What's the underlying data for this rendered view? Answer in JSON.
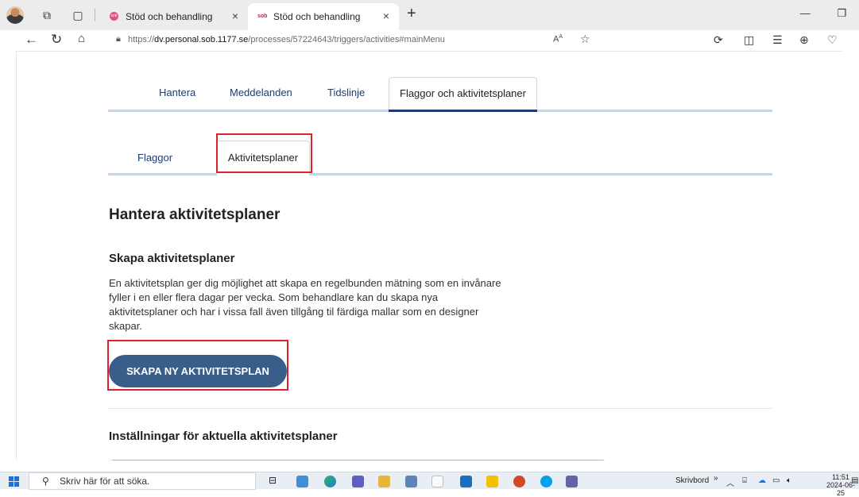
{
  "browser": {
    "tabs": [
      {
        "title": "Stöd och behandling",
        "active": false
      },
      {
        "title": "Stöd och behandling",
        "active": true
      }
    ],
    "url_prefix": "https://",
    "url_host": "dv.personal.sob.1177.se",
    "url_path": "/processes/57224643/triggers/activities#mainMenu",
    "read_aloud_label": "A̶",
    "new_tab_glyph": "+",
    "window": {
      "minimize": "—",
      "restore": "❐"
    }
  },
  "main_tabs": [
    {
      "label": "Hantera"
    },
    {
      "label": "Meddelanden"
    },
    {
      "label": "Tidslinje"
    },
    {
      "label": "Flaggor och aktivitetsplaner",
      "active": true
    }
  ],
  "sub_tabs": [
    {
      "label": "Flaggor"
    },
    {
      "label": "Aktivitetsplaner",
      "active": true
    }
  ],
  "content": {
    "heading": "Hantera aktivitetsplaner",
    "subheading": "Skapa aktivitetsplaner",
    "description": "En aktivitetsplan ger dig möjlighet att skapa en regelbunden mätning som en invånare fyller i en eller flera dagar per vecka. Som behandlare kan du skapa nya aktivitetsplaner och har i vissa fall även tillgång til färdiga mallar som en designer skapar.",
    "create_button": "SKAPA NY AKTIVITETSPLAN",
    "settings_heading": "Inställningar för aktuella aktivitetsplaner"
  },
  "taskbar": {
    "search_placeholder": "Skriv här för att söka.",
    "desktop_label": "Skrivbord",
    "time": "11:51",
    "date": "2024-06-25"
  },
  "colors": {
    "accent": "#1f3b6b",
    "button": "#3a5e8a",
    "highlight": "#e0202a"
  }
}
